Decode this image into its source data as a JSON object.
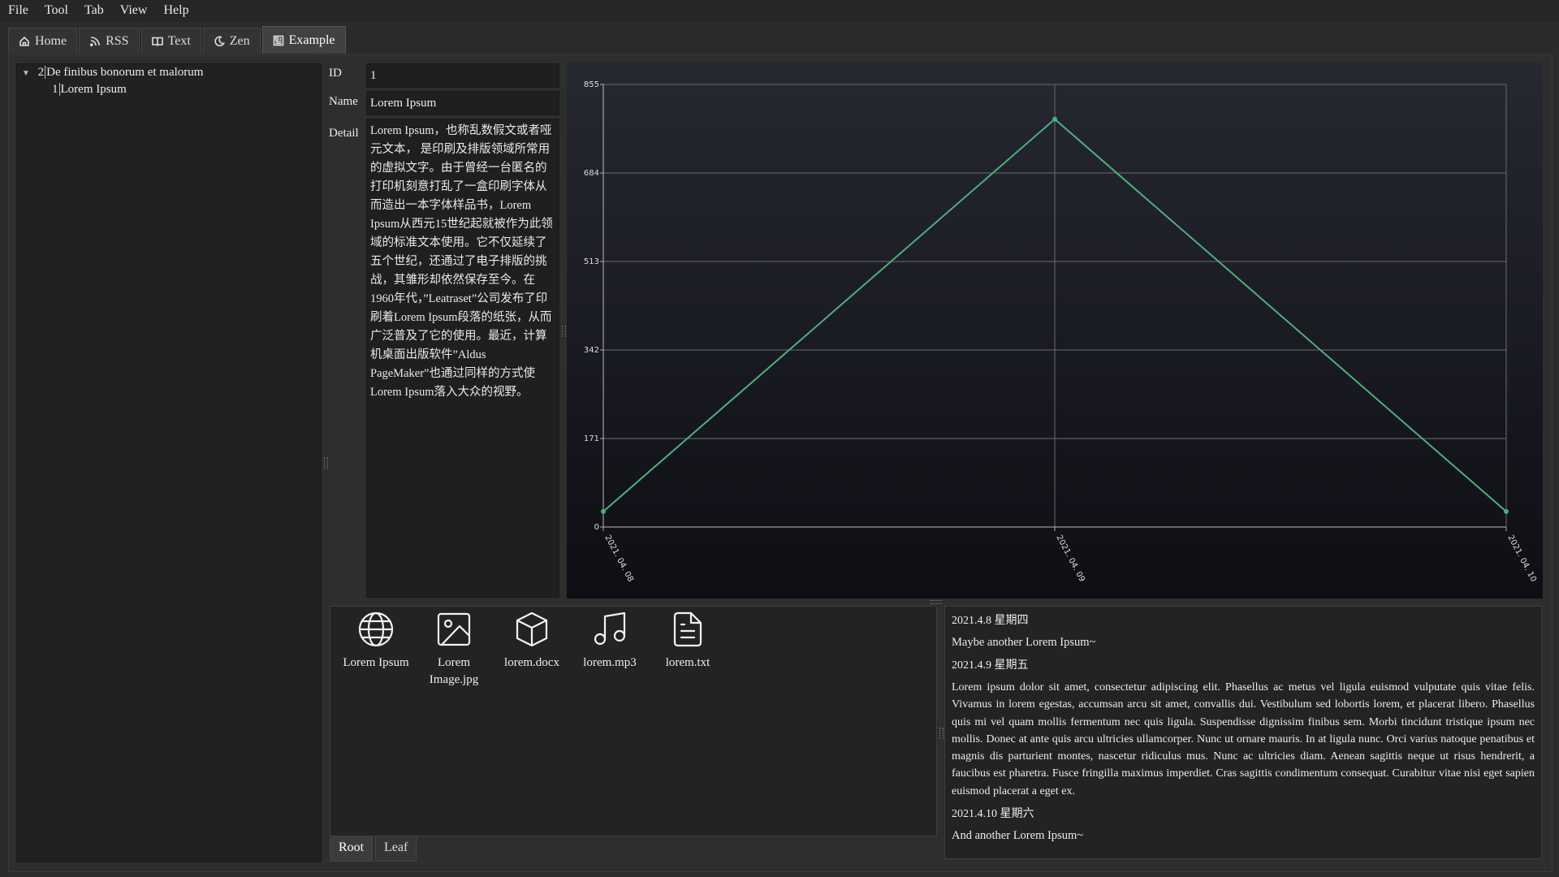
{
  "menu": [
    "File",
    "Tool",
    "Tab",
    "View",
    "Help"
  ],
  "tabs": [
    {
      "label": "Home",
      "icon": "home-icon"
    },
    {
      "label": "RSS",
      "icon": "rss-icon"
    },
    {
      "label": "Text",
      "icon": "book-icon"
    },
    {
      "label": "Zen",
      "icon": "moon-icon"
    },
    {
      "label": "Example",
      "icon": "newspaper-icon",
      "active": true
    }
  ],
  "tree": {
    "root": {
      "num": "2",
      "label": "De finibus bonorum et malorum",
      "expanded": true
    },
    "child": {
      "num": "1",
      "label": "Lorem Ipsum"
    }
  },
  "form": {
    "id_label": "ID",
    "id_value": "1",
    "name_label": "Name",
    "name_value": "Lorem Ipsum",
    "detail_label": "Detail",
    "detail_value": "Lorem Ipsum，也称乱数假文或者哑元文本， 是印刷及排版领域所常用的虚拟文字。由于曾经一台匿名的打印机刻意打乱了一盒印刷字体从而造出一本字体样品书，Lorem Ipsum从西元15世纪起就被作为此领域的标准文本使用。它不仅延续了五个世纪，还通过了电子排版的挑战，其雏形却依然保存至今。在1960年代，”Leatraset”公司发布了印刷着Lorem Ipsum段落的纸张，从而广泛普及了它的使用。最近，计算机桌面出版软件”Aldus PageMaker”也通过同样的方式使Lorem Ipsum落入大众的视野。"
  },
  "chart_data": {
    "type": "line",
    "x": [
      "2021. 04. 08",
      "2021. 04. 09",
      "2021. 04. 10"
    ],
    "values": [
      30,
      788,
      30
    ],
    "yticks": [
      0,
      171,
      342,
      513,
      684,
      855
    ],
    "ylim": [
      0,
      855
    ],
    "grid": true,
    "line_color": "#4caf7d"
  },
  "files": [
    {
      "label": "Lorem Ipsum",
      "icon": "globe-icon"
    },
    {
      "label": "Lorem Image.jpg",
      "icon": "image-icon"
    },
    {
      "label": "lorem.docx",
      "icon": "box-icon"
    },
    {
      "label": "lorem.mp3",
      "icon": "music-icon"
    },
    {
      "label": "lorem.txt",
      "icon": "file-text-icon"
    }
  ],
  "bottom_tabs": [
    "Root",
    "Leaf"
  ],
  "log": {
    "d1": "2021.4.8 星期四",
    "t1": "Maybe another Lorem Ipsum~",
    "d2": "2021.4.9 星期五",
    "p2": "Lorem ipsum dolor sit amet, consectetur adipiscing elit. Phasellus ac metus vel ligula euismod vulputate quis vitae felis. Vivamus in lorem egestas, accumsan arcu sit amet, convallis dui. Vestibulum sed lobortis lorem, et placerat libero. Phasellus quis mi vel quam mollis fermentum nec quis ligula. Suspendisse dignissim finibus sem. Morbi tincidunt tristique ipsum nec mollis. Donec at ante quis arcu ultricies ullamcorper. Nunc ut ornare mauris. In at ligula nunc. Orci varius natoque penatibus et magnis dis parturient montes, nascetur ridiculus mus. Nunc ac ultricies diam. Aenean sagittis neque ut risus hendrerit, a faucibus est pharetra. Fusce fringilla maximus imperdiet. Cras sagittis condimentum consequat. Curabitur vitae nisi eget sapien euismod placerat a eget ex.",
    "d3": "2021.4.10 星期六",
    "t3": "And another Lorem Ipsum~"
  }
}
